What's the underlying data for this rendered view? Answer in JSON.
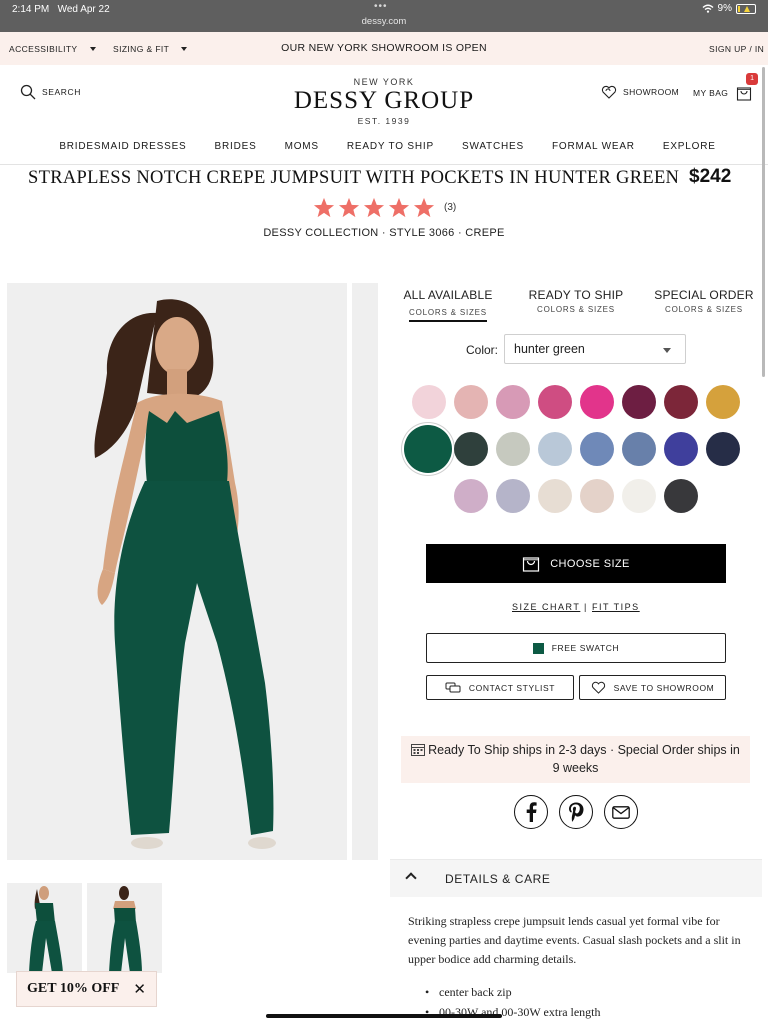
{
  "status": {
    "time": "2:14 PM",
    "date": "Wed Apr 22",
    "url": "dessy.com",
    "battery": "9%"
  },
  "promo": {
    "accessibility": "ACCESSIBILITY",
    "sizing": "SIZING & FIT",
    "center": "OUR NEW YORK SHOWROOM IS OPEN",
    "signin": "SIGN UP / IN"
  },
  "header": {
    "search": "SEARCH",
    "logo_top": "NEW YORK",
    "logo_main": "DESSY GROUP",
    "logo_bottom": "EST. 1939",
    "showroom": "SHOWROOM",
    "mybag": "MY BAG",
    "bag_count": "1"
  },
  "nav": [
    "BRIDESMAID DRESSES",
    "BRIDES",
    "MOMS",
    "READY TO SHIP",
    "SWATCHES",
    "FORMAL WEAR",
    "EXPLORE"
  ],
  "product": {
    "title": "STRAPLESS NOTCH CREPE JUMPSUIT WITH POCKETS IN HUNTER GREEN",
    "price": "$242",
    "rating": 5,
    "review_count": "(3)",
    "meta": "DESSY COLLECTION · STYLE 3066 · CREPE"
  },
  "tabs": [
    {
      "title": "ALL AVAILABLE",
      "sub": "COLORS & SIZES"
    },
    {
      "title": "READY TO SHIP",
      "sub": "COLORS & SIZES"
    },
    {
      "title": "SPECIAL ORDER",
      "sub": "COLORS & SIZES"
    }
  ],
  "color": {
    "label": "Color:",
    "value": "hunter green",
    "selected_hex": "#0d5a44"
  },
  "swatches": [
    [
      "#f2d3da",
      "#e4b4b3",
      "#d79ab6",
      "#cf4d82",
      "#e2348b",
      "#6d1e42",
      "#7c2639",
      "#d5a13c"
    ],
    [
      "#0d5a44",
      "#2f403c",
      "#c6c9bf",
      "#b9c8d8",
      "#6f89b8",
      "#6880aa",
      "#3f3f9c",
      "#262d47"
    ],
    [
      "#cfaec8",
      "#b5b4c9",
      "#e7ddd3",
      "#e4d2c9",
      "#f1efea",
      "#38383b"
    ]
  ],
  "actions": {
    "choose_size": "CHOOSE SIZE",
    "size_chart": "SIZE CHART",
    "separator": "|",
    "fit_tips": "FIT TIPS",
    "free_swatch": "FREE SWATCH",
    "contact_stylist": "CONTACT STYLIST",
    "save_showroom": "SAVE TO SHOWROOM"
  },
  "shipping": {
    "line1": "Ready To Ship ships in 2-3 days · Special Order ships in",
    "line2": "9 weeks"
  },
  "details": {
    "heading": "DETAILS & CARE",
    "body": "Striking strapless crepe jumpsuit lends casual yet formal vibe for evening parties and daytime events. Casual slash pockets and a slit in upper bodice add charming details.",
    "bullets": [
      "center back zip",
      "00-30W and 00-30W extra length"
    ]
  },
  "offer": {
    "label": "GET 10% OFF"
  }
}
